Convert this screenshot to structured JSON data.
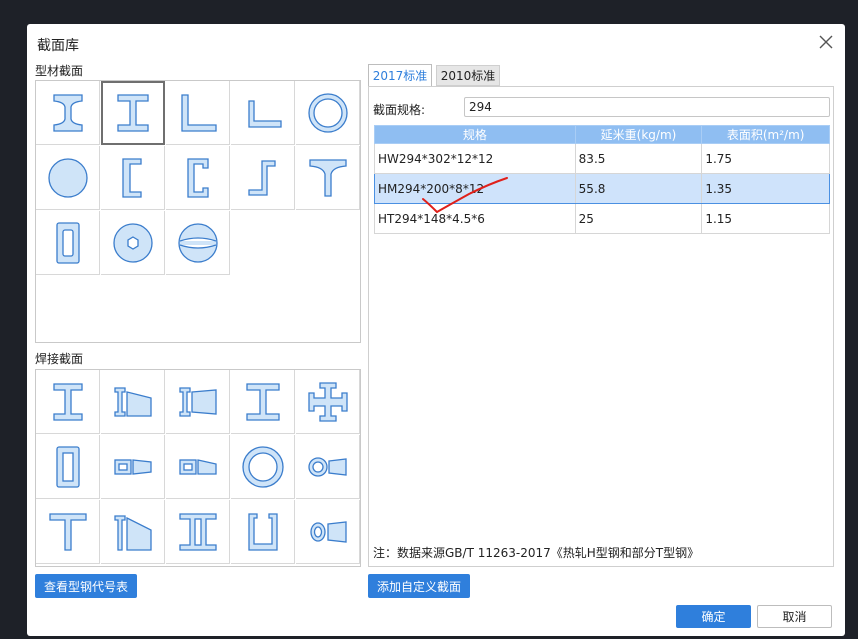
{
  "dialog": {
    "title": "截面库"
  },
  "left": {
    "profile_label": "型材截面",
    "welded_label": "焊接截面",
    "profile_icons": [
      "i-beam-icon",
      "h-beam-icon",
      "equal-angle-icon",
      "unequal-angle-icon",
      "round-tube-icon",
      "round-bar-icon",
      "channel-icon",
      "channel-lipped-icon",
      "z-section-icon",
      "t-section-icon",
      "rect-tube-icon",
      "hex-bar-icon",
      "split-sphere-icon"
    ],
    "welded_icons": [
      "welded-i-icon",
      "tapered-i-left-icon",
      "tapered-i-right-icon",
      "welded-h-icon",
      "cross-section-icon",
      "welded-box-icon",
      "tapered-box-left-icon",
      "tapered-box-right-icon",
      "circle-tube-icon",
      "tapered-tube-icon",
      "welded-t-icon",
      "tapered-t-icon",
      "double-channel-icon",
      "u-section-icon",
      "tapered-round-icon"
    ],
    "view_codes_button": "查看型钢代号表"
  },
  "right": {
    "tabs": [
      {
        "label": "2017标准",
        "active": true
      },
      {
        "label": "2010标准",
        "active": false
      }
    ],
    "spec_label": "截面规格:",
    "spec_value": "294",
    "table": {
      "headers": [
        "规格",
        "延米重(kg/m)",
        "表面积(m²/m)"
      ],
      "rows": [
        {
          "spec": "HW294*302*12*12",
          "weight": "83.5",
          "area": "1.75",
          "selected": false
        },
        {
          "spec": "HM294*200*8*12",
          "weight": "55.8",
          "area": "1.35",
          "selected": true
        },
        {
          "spec": "HT294*148*4.5*6",
          "weight": "25",
          "area": "1.15",
          "selected": false
        }
      ]
    },
    "note": "注：数据来源GB/T 11263-2017《热轧H型钢和部分T型钢》",
    "add_custom_button": "添加自定义截面"
  },
  "footer": {
    "ok": "确定",
    "cancel": "取消"
  },
  "colors": {
    "accent": "#2f7fdc",
    "header_blue": "#8fbef2",
    "selected_row": "#cfe3fb",
    "icon_fill": "#cfe4f8",
    "icon_stroke": "#3b7dcc",
    "annotation_red": "#e0201a"
  }
}
